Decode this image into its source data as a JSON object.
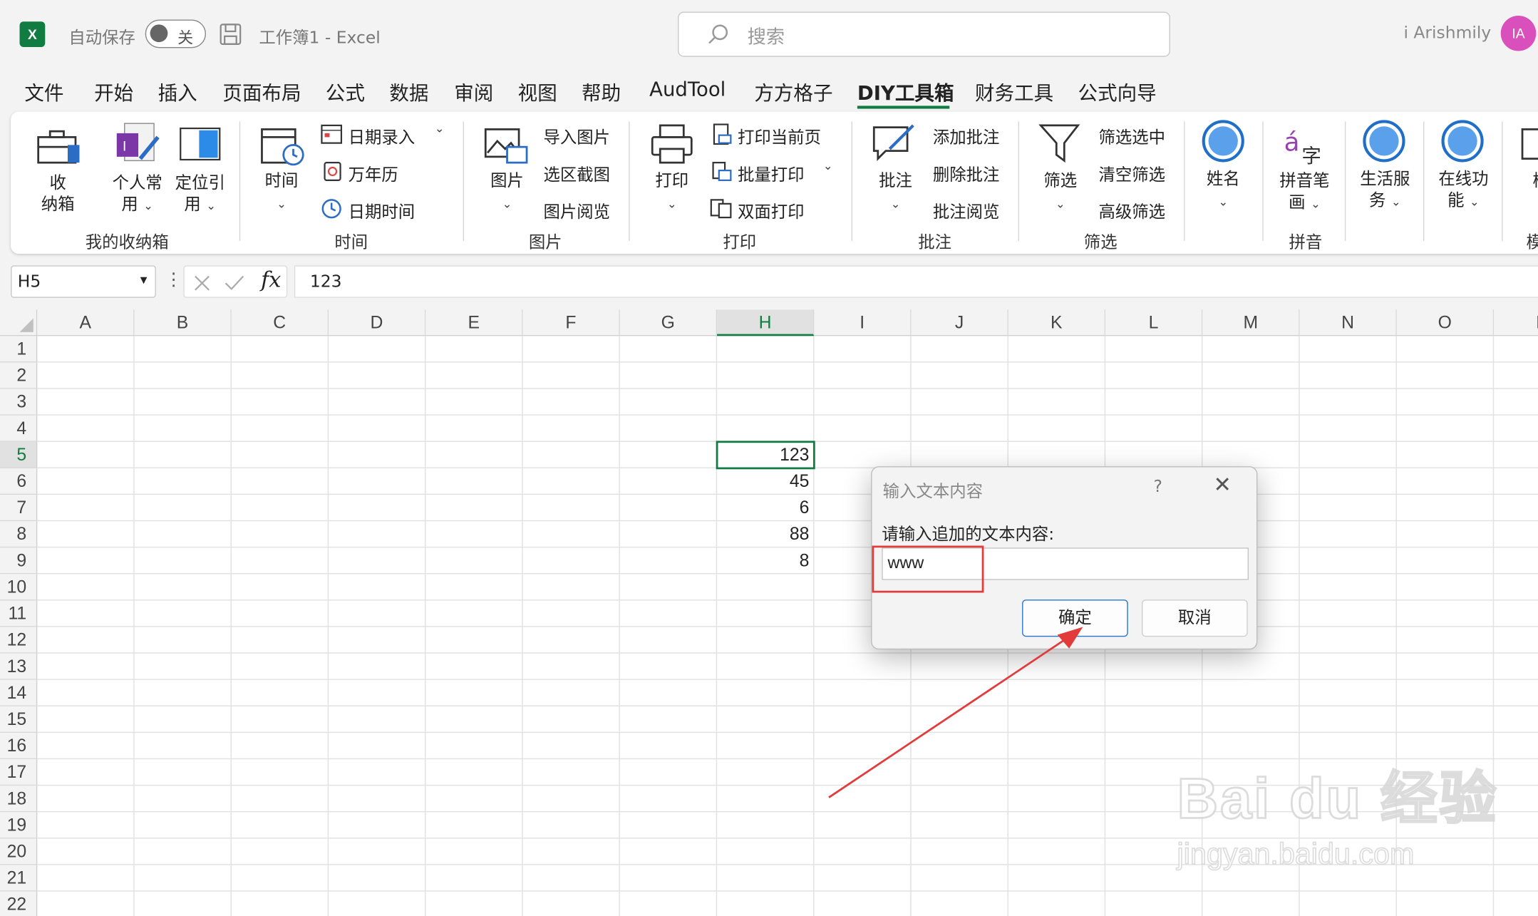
{
  "titlebar": {
    "autosave_label": "自动保存",
    "autosave_state": "关",
    "doc_title": "工作簿1  -  Excel",
    "search_placeholder": "搜索",
    "user_name": "i Arishmily",
    "avatar_initials": "IA",
    "logo_letter": "X"
  },
  "menu": [
    "文件",
    "开始",
    "插入",
    "页面布局",
    "公式",
    "数据",
    "审阅",
    "视图",
    "帮助",
    "AudTool",
    "方方格子",
    "DIY工具箱",
    "财务工具",
    "公式向导"
  ],
  "active_menu": "DIY工具箱",
  "ribbon": {
    "groups": {
      "storage": "我的收纳箱",
      "time": "时间",
      "picture": "图片",
      "print": "打印",
      "comment": "批注",
      "filter": "筛选",
      "pinyin": "拼音"
    },
    "storage_btn1_l1": "收",
    "storage_btn1_l2": "纳箱",
    "storage_btn2_l1": "个人常",
    "storage_btn2_l2": "用",
    "storage_btn3_l1": "定位引",
    "storage_btn3_l2": "用",
    "time_btn": "时间",
    "time_items": [
      "日期录入",
      "万年历",
      "日期时间"
    ],
    "picture_btn": "图片",
    "picture_items": [
      "导入图片",
      "选区截图",
      "图片阅览"
    ],
    "print_btn": "打印",
    "print_items": [
      "打印当前页",
      "批量打印",
      "双面打印"
    ],
    "comment_btn": "批注",
    "comment_items": [
      "添加批注",
      "删除批注",
      "批注阅览"
    ],
    "filter_btn": "筛选",
    "filter_items": [
      "筛选选中",
      "清空筛选",
      "高级筛选"
    ],
    "name_btn": "姓名",
    "pinyin_btn_l1": "拼音笔",
    "pinyin_btn_l2": "画",
    "life_btn_l1": "生活服",
    "life_btn_l2": "务",
    "online_btn_l1": "在线功",
    "online_btn_l2": "能",
    "cut_btn": "模",
    "cut_group": "模"
  },
  "formula_bar": {
    "name_box": "H5",
    "formula": "123",
    "fx_label": "fx"
  },
  "sheet": {
    "columns": [
      "A",
      "B",
      "C",
      "D",
      "E",
      "F",
      "G",
      "H",
      "I",
      "J",
      "K",
      "L",
      "M",
      "N",
      "O",
      "P"
    ],
    "rows": [
      "1",
      "2",
      "3",
      "4",
      "5",
      "6",
      "7",
      "8",
      "9",
      "10",
      "11",
      "12",
      "13",
      "14",
      "15",
      "16",
      "17",
      "18",
      "19",
      "20",
      "21",
      "22"
    ],
    "selected_column": "H",
    "selected_row": "5",
    "h_column_values": [
      "123",
      "45",
      "6",
      "88",
      "8"
    ]
  },
  "dialog": {
    "title": "输入文本内容",
    "help": "?",
    "close": "✕",
    "prompt": "请输入追加的文本内容:",
    "input_value": "www",
    "ok_label": "确定",
    "cancel_label": "取消"
  },
  "watermark": {
    "main": "Bai du 经验",
    "sub": "jingyan.baidu.com"
  },
  "colors": {
    "excel_green": "#107c41",
    "annotation_red": "#e23b3b",
    "dialog_ok_border": "#2874d0"
  }
}
